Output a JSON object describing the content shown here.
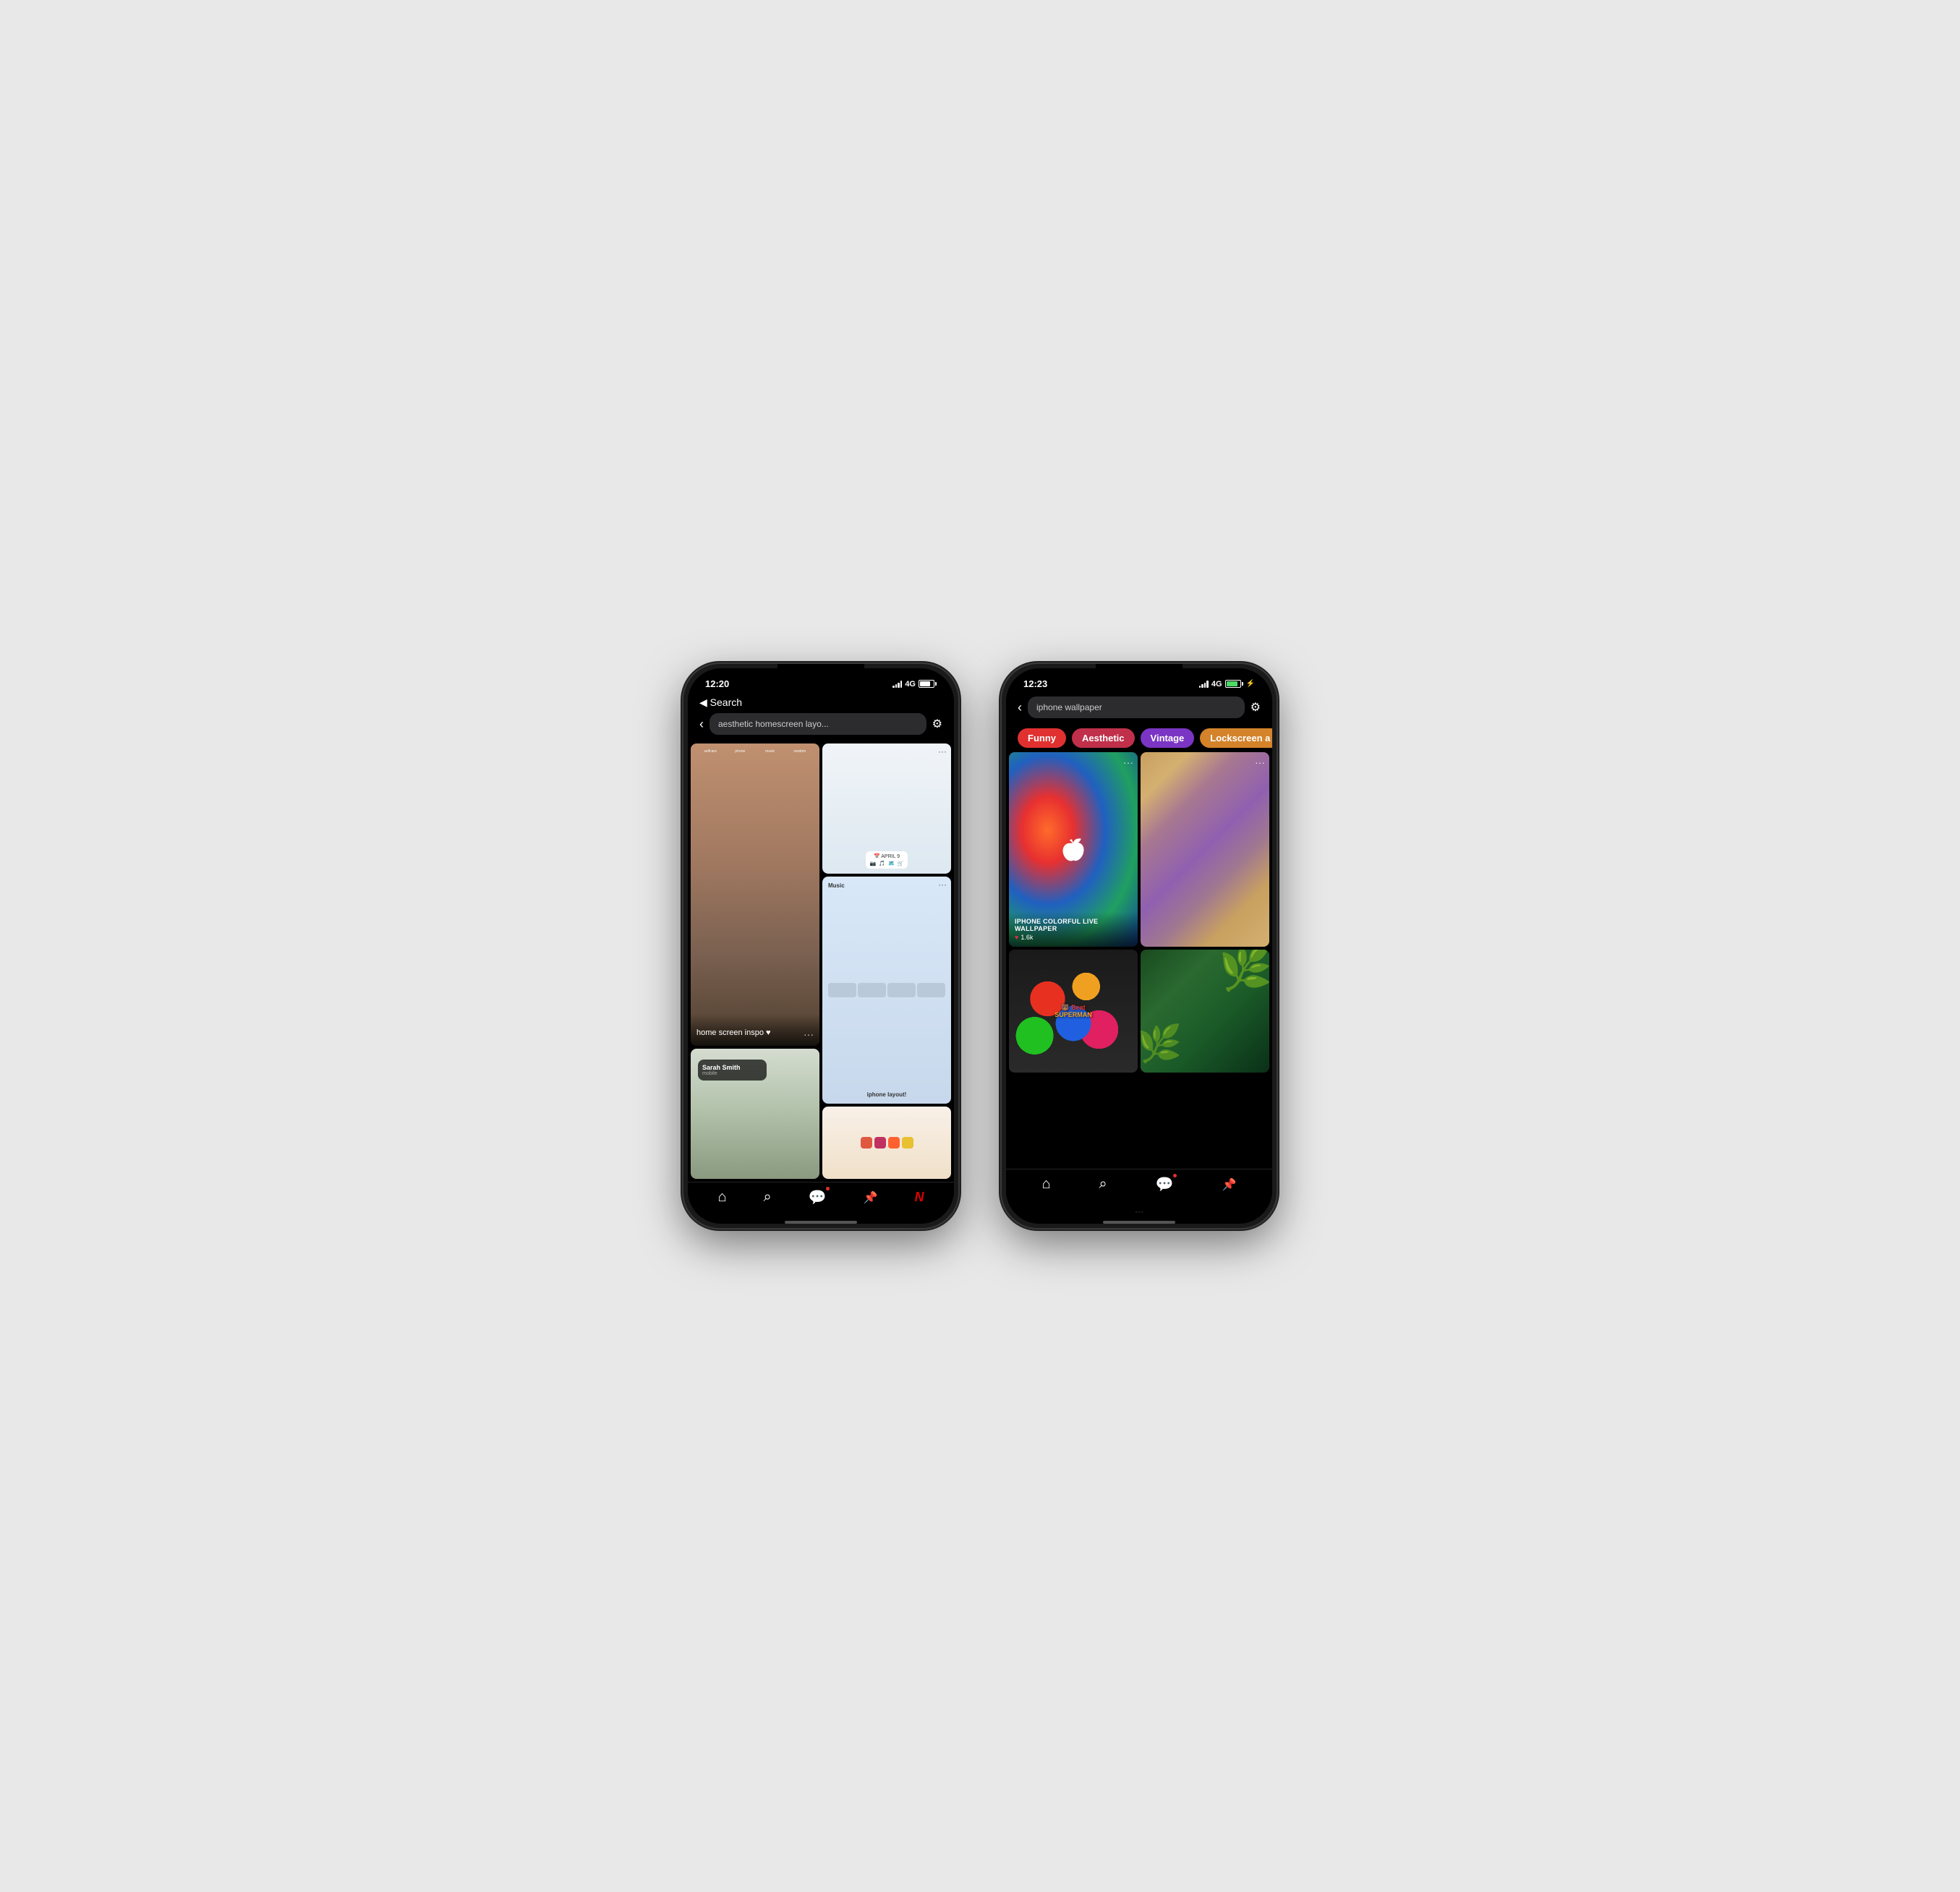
{
  "phone1": {
    "status": {
      "time": "12:20",
      "signal": "4G",
      "battery": "normal"
    },
    "nav": {
      "back_text": "◀ Search"
    },
    "search": {
      "placeholder": "aesthetic homescreen layo...",
      "value": "aesthetic homescreen layo..."
    },
    "posts": [
      {
        "id": "p1",
        "title": "home screen inspo ♥",
        "image_type": "homescreen",
        "height": "tall"
      },
      {
        "id": "p2",
        "title": "iphone layout!",
        "image_type": "ios-widget",
        "height": "normal"
      },
      {
        "id": "p3",
        "title": "",
        "image_type": "phone-hand",
        "height": "normal"
      },
      {
        "id": "p4",
        "title": "",
        "image_type": "ios2",
        "height": "normal"
      }
    ],
    "bottom_nav": {
      "items": [
        {
          "icon": "⌂",
          "label": "home",
          "dot": false
        },
        {
          "icon": "⌕",
          "label": "search",
          "dot": false
        },
        {
          "icon": "💬",
          "label": "messages",
          "dot": true
        },
        {
          "icon": "📌",
          "label": "pin",
          "dot": false
        },
        {
          "icon": "N",
          "label": "netflix",
          "dot": false
        }
      ]
    }
  },
  "phone2": {
    "status": {
      "time": "12:23",
      "signal": "4G",
      "battery": "charging"
    },
    "nav": {
      "back_arrow": "‹"
    },
    "search": {
      "value": "iphone wallpaper"
    },
    "tags": [
      {
        "label": "Funny",
        "color": "red"
      },
      {
        "label": "Aesthetic",
        "color": "pink"
      },
      {
        "label": "Vintage",
        "color": "purple"
      },
      {
        "label": "Lockscreen a",
        "color": "orange"
      }
    ],
    "posts": [
      {
        "id": "w1",
        "title": "IPHONE COLORFUL LIVE WALLPAPER",
        "likes": "1.6k",
        "image_type": "colorful",
        "height": "tall"
      },
      {
        "id": "w2",
        "title": "",
        "likes": "",
        "image_type": "marble",
        "height": "tall"
      },
      {
        "id": "w3",
        "title": "",
        "likes": "",
        "image_type": "stickers",
        "height": "normal"
      },
      {
        "id": "w4",
        "title": "",
        "likes": "",
        "image_type": "tropical",
        "height": "normal"
      }
    ],
    "bottom_nav": {
      "items": [
        {
          "icon": "⌂",
          "label": "home",
          "dot": false
        },
        {
          "icon": "⌕",
          "label": "search",
          "dot": false
        },
        {
          "icon": "💬",
          "label": "messages",
          "dot": true
        },
        {
          "icon": "📌",
          "label": "pin",
          "dot": false
        }
      ]
    }
  }
}
